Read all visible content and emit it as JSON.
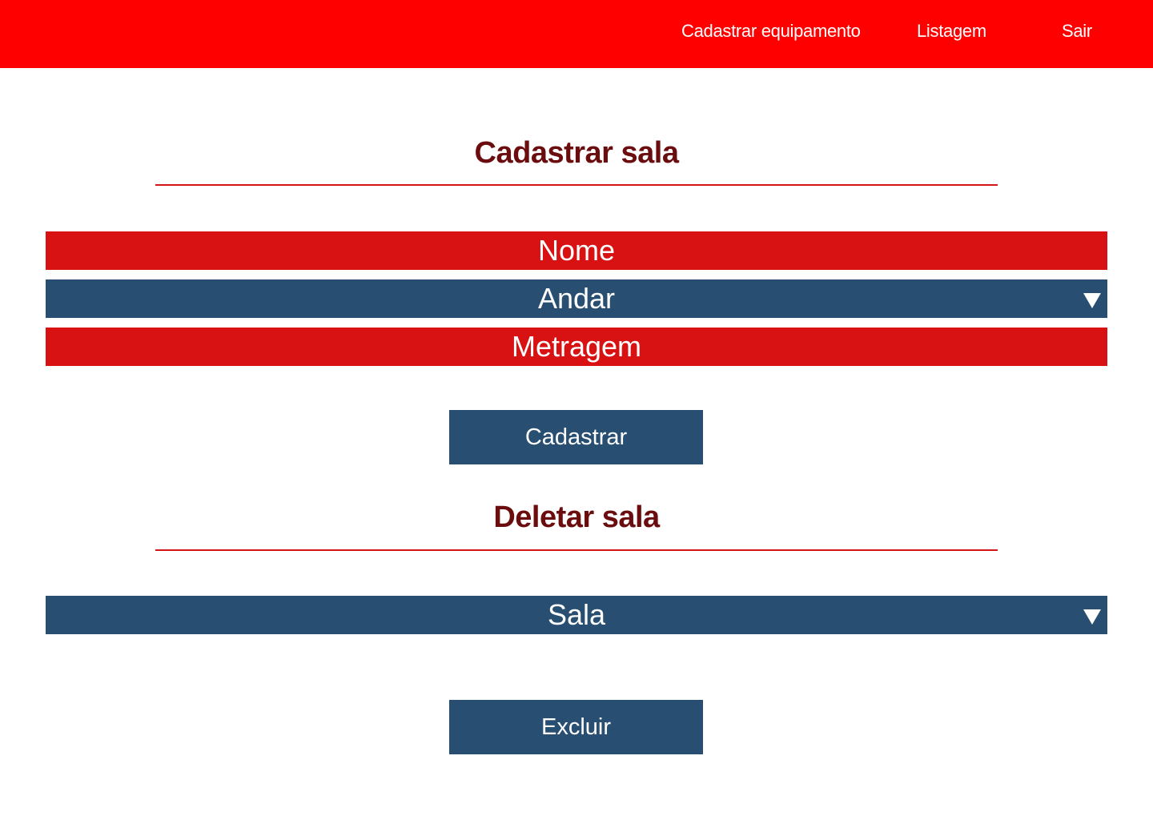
{
  "header": {
    "nav": {
      "cadastrar_equipamento": "Cadastrar equipamento",
      "listagem": "Listagem",
      "sair": "Sair"
    }
  },
  "cadastrar_section": {
    "title": "Cadastrar sala",
    "fields": {
      "nome_placeholder": "Nome",
      "andar_label": "Andar",
      "metragem_placeholder": "Metragem"
    },
    "submit_label": "Cadastrar"
  },
  "deletar_section": {
    "title": "Deletar sala",
    "sala_label": "Sala",
    "submit_label": "Excluir"
  },
  "colors": {
    "topbar": "#ff0000",
    "title_text": "#6b0d0f",
    "divider": "#d71414",
    "field_red": "#d81212",
    "field_blue": "#284f72",
    "button": "#284f72"
  }
}
